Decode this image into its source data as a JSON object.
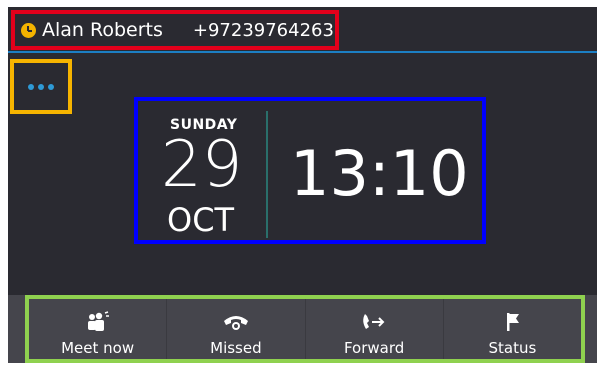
{
  "header": {
    "user_name": "Alan Roberts",
    "phone_number": "+97239764263",
    "status_icon": "clock-away-icon",
    "status_color": "#f4b400",
    "accent_line_color": "#1c7fc4"
  },
  "more_button": {
    "icon": "more-dots-icon",
    "color": "#2e9ad6"
  },
  "clock": {
    "day": "SUNDAY",
    "date": "29",
    "month": "OCT",
    "time": "13:10"
  },
  "softkeys": [
    {
      "label": "Meet now",
      "icon": "meet-now-icon"
    },
    {
      "label": "Missed",
      "icon": "missed-call-icon"
    },
    {
      "label": "Forward",
      "icon": "forward-call-icon"
    },
    {
      "label": "Status",
      "icon": "status-flag-icon"
    }
  ],
  "colors": {
    "screen_bg": "#2a2a31",
    "softkey_bg": "#45454c",
    "highlight_header": "#e3001b",
    "highlight_more": "#f6b400",
    "highlight_clock": "#0000ff",
    "highlight_softkeys": "#8fd14f"
  }
}
